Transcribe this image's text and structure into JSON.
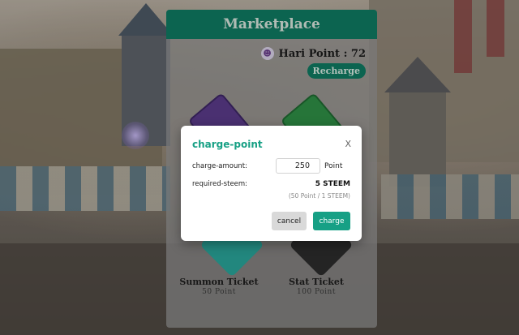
{
  "marketplace": {
    "title": "Marketplace",
    "points_label": "Hari Point : 72",
    "recharge_label": "Recharge",
    "tickets": [
      {
        "name": "Summon Ticket",
        "price": "50 Point"
      },
      {
        "name": "Stat Ticket",
        "price": "100 Point"
      }
    ]
  },
  "modal": {
    "title": "charge-point",
    "close_label": "X",
    "amount_label": "charge-amount:",
    "amount_value": "250",
    "amount_unit": "Point",
    "steem_label": "required-steem:",
    "steem_value": "5 STEEM",
    "rate_note": "(50 Point / 1 STEEM)",
    "cancel_label": "cancel",
    "charge_label": "charge"
  },
  "colors": {
    "brand_green": "#0f7a62",
    "accent_teal": "#17a085"
  },
  "icons": {
    "avatar": "user-avatar-icon",
    "ticket_symbols": [
      "ticket-icon",
      "refresh-icon"
    ]
  }
}
